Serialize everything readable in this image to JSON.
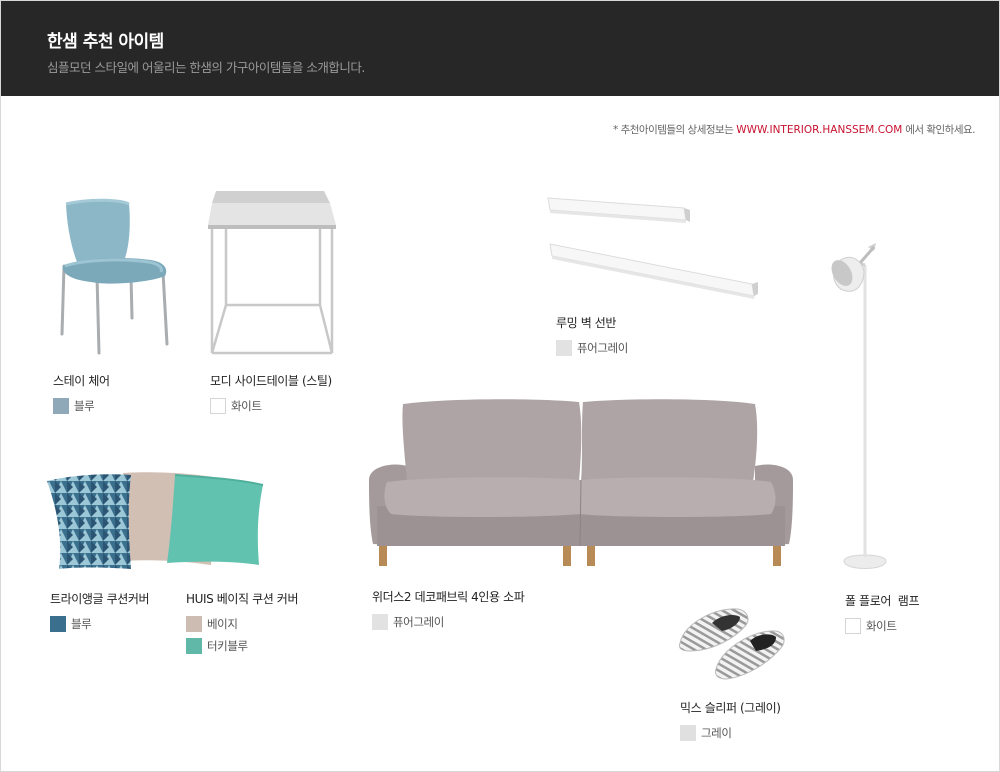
{
  "header": {
    "title": "한샘 추천 아이템",
    "subtitle": "심플모던 스타일에 어울리는 한샘의 가구아이템들을 소개합니다."
  },
  "notice": {
    "prefix": "* 추천아이템들의 상세정보는",
    "url": "WWW.INTERIOR.HANSSEM.COM",
    "suffix": "에서 확인하세요."
  },
  "colors": {
    "header_bg": "#272727",
    "url_red": "#c8102e",
    "swatch_blue_gray": "#8fa9b8",
    "swatch_white": "#ffffff",
    "swatch_pure_gray": "#e2e2e2",
    "swatch_steel_blue": "#3b6f8e",
    "swatch_beige": "#cdbcb2",
    "swatch_turquoise": "#5fb8a8",
    "swatch_gray": "#e0e0e0"
  },
  "products": {
    "stay_chair": {
      "name": "스테이 체어",
      "image": "chair-image",
      "colors": [
        {
          "label": "블루",
          "hex": "#8fa9b8"
        }
      ]
    },
    "modi_side_table": {
      "name": "모디 사이드테이블 (스틸)",
      "image": "side-table-image",
      "colors": [
        {
          "label": "화이트",
          "hex": "#ffffff"
        }
      ]
    },
    "rooming_shelf": {
      "name": "루밍 벽 선반",
      "image": "wall-shelf-image",
      "colors": [
        {
          "label": "퓨어그레이",
          "hex": "#e2e2e2"
        }
      ]
    },
    "floor_lamp": {
      "name": "폴 플로어  램프",
      "image": "floor-lamp-image",
      "colors": [
        {
          "label": "화이트",
          "hex": "#ffffff"
        }
      ]
    },
    "triangle_cushion": {
      "name": "트라이앵글 쿠션커버",
      "image": "cushions-image",
      "colors": [
        {
          "label": "블루",
          "hex": "#3b6f8e"
        }
      ]
    },
    "huis_cushion": {
      "name": "HUIS 베이직 쿠션 커버",
      "colors": [
        {
          "label": "베이지",
          "hex": "#cdbcb2"
        },
        {
          "label": "터키블루",
          "hex": "#5fb8a8"
        }
      ]
    },
    "widders_sofa": {
      "name": "위더스2 데코패브릭 4인용 소파",
      "image": "sofa-image",
      "colors": [
        {
          "label": "퓨어그레이",
          "hex": "#e2e2e2"
        }
      ]
    },
    "mix_slipper": {
      "name": "믹스 슬리퍼 (그레이)",
      "image": "slippers-image",
      "colors": [
        {
          "label": "그레이",
          "hex": "#e0e0e0"
        }
      ]
    }
  }
}
